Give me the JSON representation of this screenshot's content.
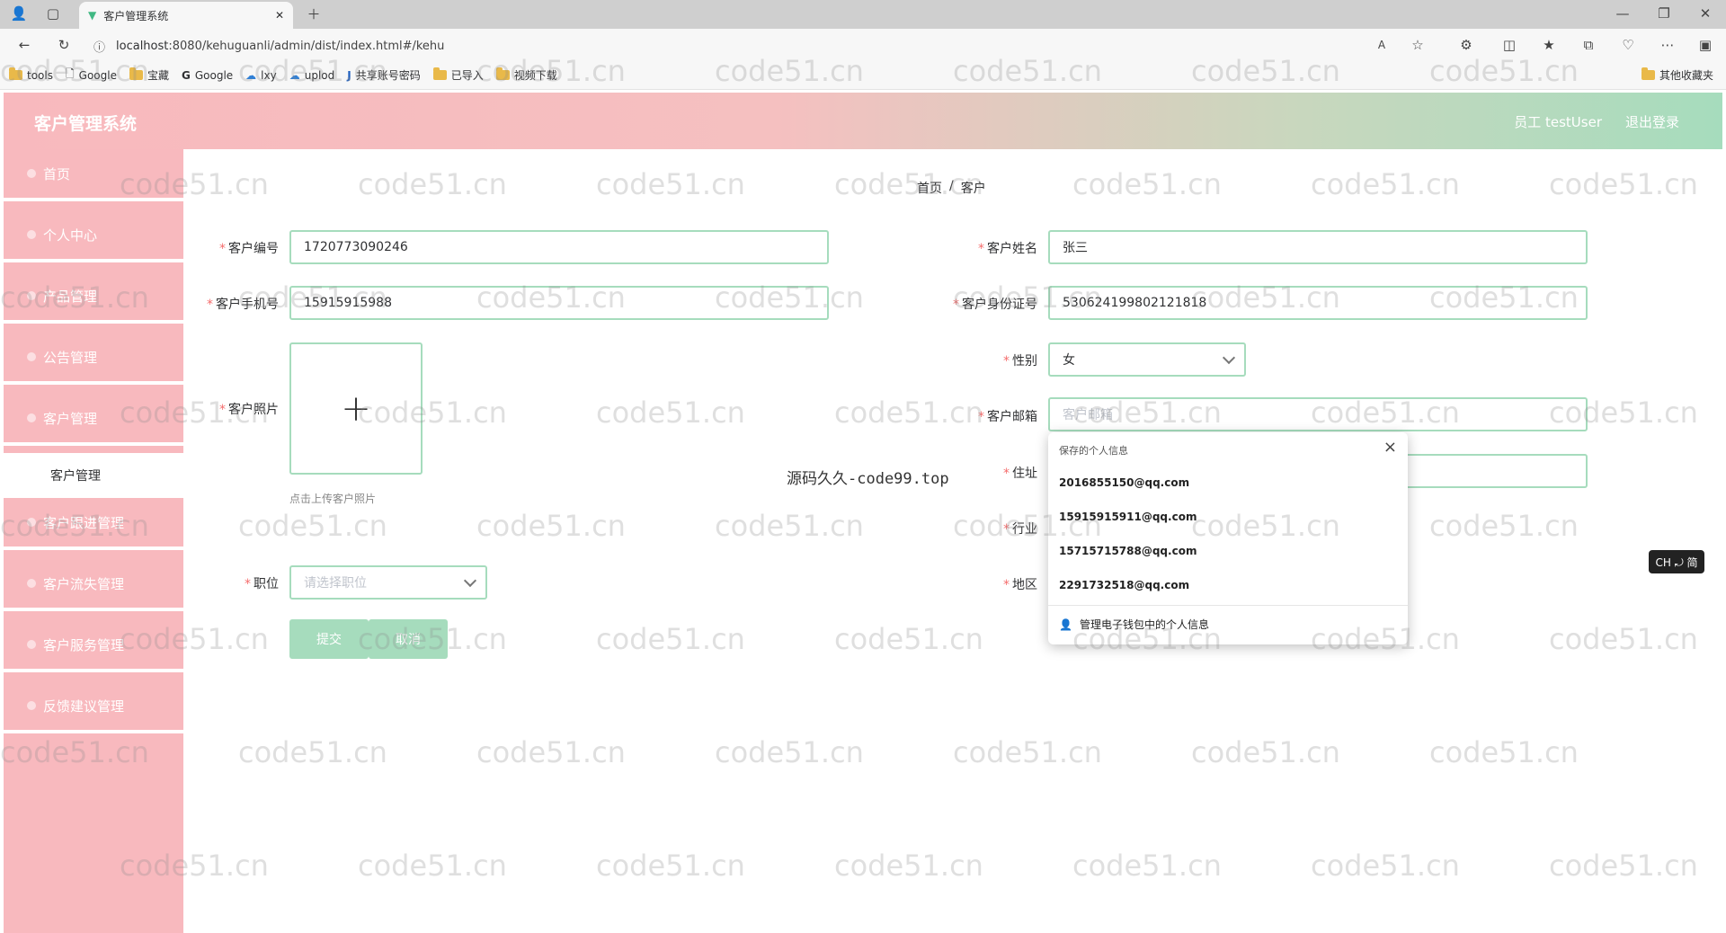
{
  "browser": {
    "tab_title": "客户管理系统",
    "url_host": "localhost",
    "url_rest": ":8080/kehuguanli/admin/dist/index.html#/kehu",
    "bookmarks": [
      "tools",
      "Google",
      "宝藏",
      "Google",
      "lxy",
      "uplod",
      "共享账号密码",
      "已导入",
      "视频下载"
    ],
    "other_bookmarks": "其他收藏夹"
  },
  "header": {
    "title": "客户管理系统",
    "user": "员工 testUser",
    "logout": "退出登录"
  },
  "sidebar": {
    "items": [
      "首页",
      "个人中心",
      "产品管理",
      "公告管理",
      "客户管理"
    ],
    "submenu": "客户管理",
    "items_after": [
      "客户跟进管理",
      "客户流失管理",
      "客户服务管理",
      "反馈建议管理"
    ]
  },
  "breadcrumb": [
    "首页",
    "/",
    "客户"
  ],
  "form": {
    "code_label": "客户编号",
    "code_value": "1720773090246",
    "name_label": "客户姓名",
    "name_value": "张三",
    "phone_label": "客户手机号",
    "phone_value": "15915915988",
    "idcard_label": "客户身份证号",
    "idcard_value": "530624199802121818",
    "gender_label": "性别",
    "gender_value": "女",
    "photo_label": "客户照片",
    "upload_tip": "点击上传客户照片",
    "email_label": "客户邮箱",
    "email_placeholder": "客户邮箱",
    "address_label": "住址",
    "industry_label": "行业",
    "position_label": "职位",
    "position_placeholder": "请选择职位",
    "region_label": "地区",
    "submit": "提交",
    "cancel": "取消"
  },
  "overlay_text": "源码久久-code99.top",
  "autofill": {
    "title": "保存的个人信息",
    "emails": [
      "2016855150@qq.com",
      "15915915911@qq.com",
      "15715715788@qq.com",
      "2291732518@qq.com"
    ],
    "manage": "管理电子钱包中的个人信息"
  },
  "ime": "CH ⤾ 简",
  "watermark": "code51.cn"
}
